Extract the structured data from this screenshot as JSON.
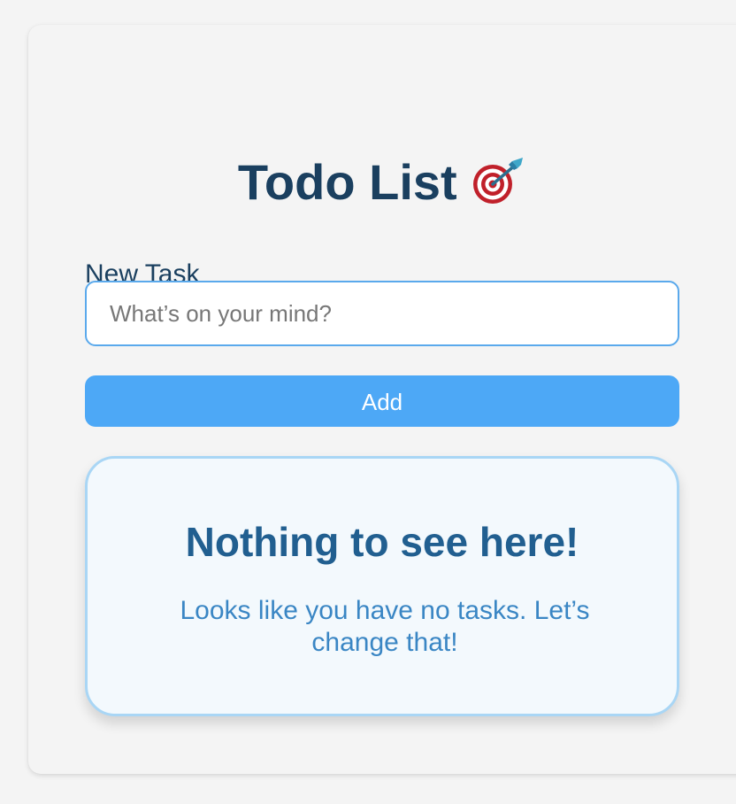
{
  "app": {
    "title": "Todo List",
    "title_icon": "target-dart-icon"
  },
  "form": {
    "label": "New Task",
    "input_value": "",
    "input_placeholder": "What’s on your mind?",
    "add_label": "Add"
  },
  "empty_state": {
    "title": "Nothing to see here!",
    "message": "Looks like you have no tasks. Let’s change that!"
  },
  "colors": {
    "heading": "#1a3f5f",
    "accent": "#4da8f6",
    "input_border": "#5aa9ec",
    "empty_border": "#a9d6f5",
    "empty_bg": "#f3f9fd",
    "empty_title": "#215f90",
    "empty_text": "#3a86c4"
  }
}
